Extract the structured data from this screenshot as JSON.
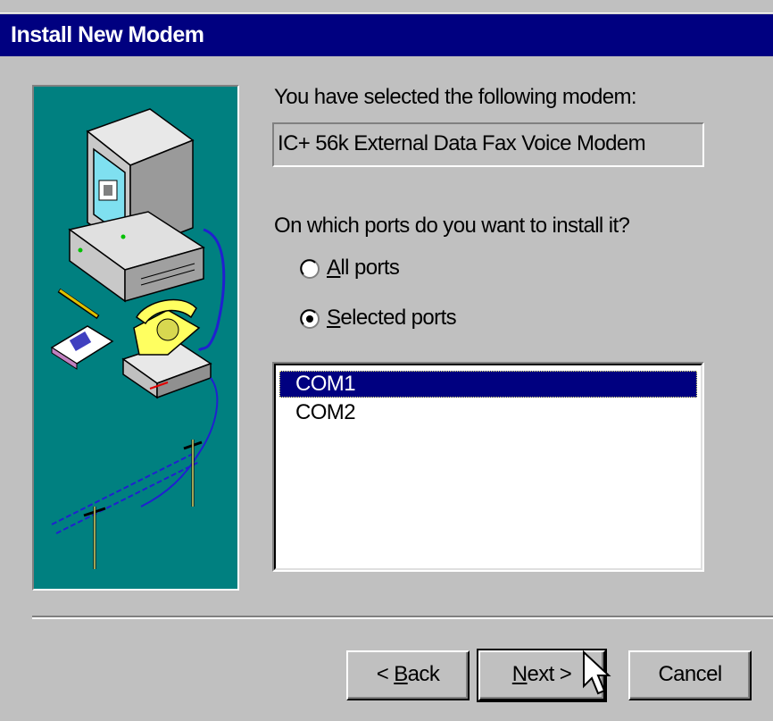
{
  "window": {
    "title": "Install New Modem"
  },
  "main": {
    "selected_label": "You have selected the following modem:",
    "modem_name": "IC+ 56k External Data Fax Voice Modem",
    "ports_question": "On which ports do you want to install it?",
    "radio_all": {
      "label": "All ports",
      "accel": "A",
      "rest": "ll ports",
      "checked": false
    },
    "radio_selected": {
      "label": "Selected ports",
      "accel": "S",
      "rest": "elected ports",
      "checked": true
    },
    "ports": [
      {
        "label": "COM1",
        "selected": true
      },
      {
        "label": "COM2",
        "selected": false
      }
    ]
  },
  "buttons": {
    "back": {
      "label": "< Back",
      "prefix": "< ",
      "accel": "B",
      "rest": "ack"
    },
    "next": {
      "label": "Next >",
      "accel": "N",
      "rest": "ext >"
    },
    "cancel": {
      "label": "Cancel"
    }
  },
  "colors": {
    "titlebar": "#000080",
    "face": "#c0c0c0",
    "art_bg": "#008080",
    "selection": "#000080"
  },
  "icons": [
    "computer-illustration",
    "telephone-modem-illustration",
    "cursor-arrow-icon"
  ]
}
